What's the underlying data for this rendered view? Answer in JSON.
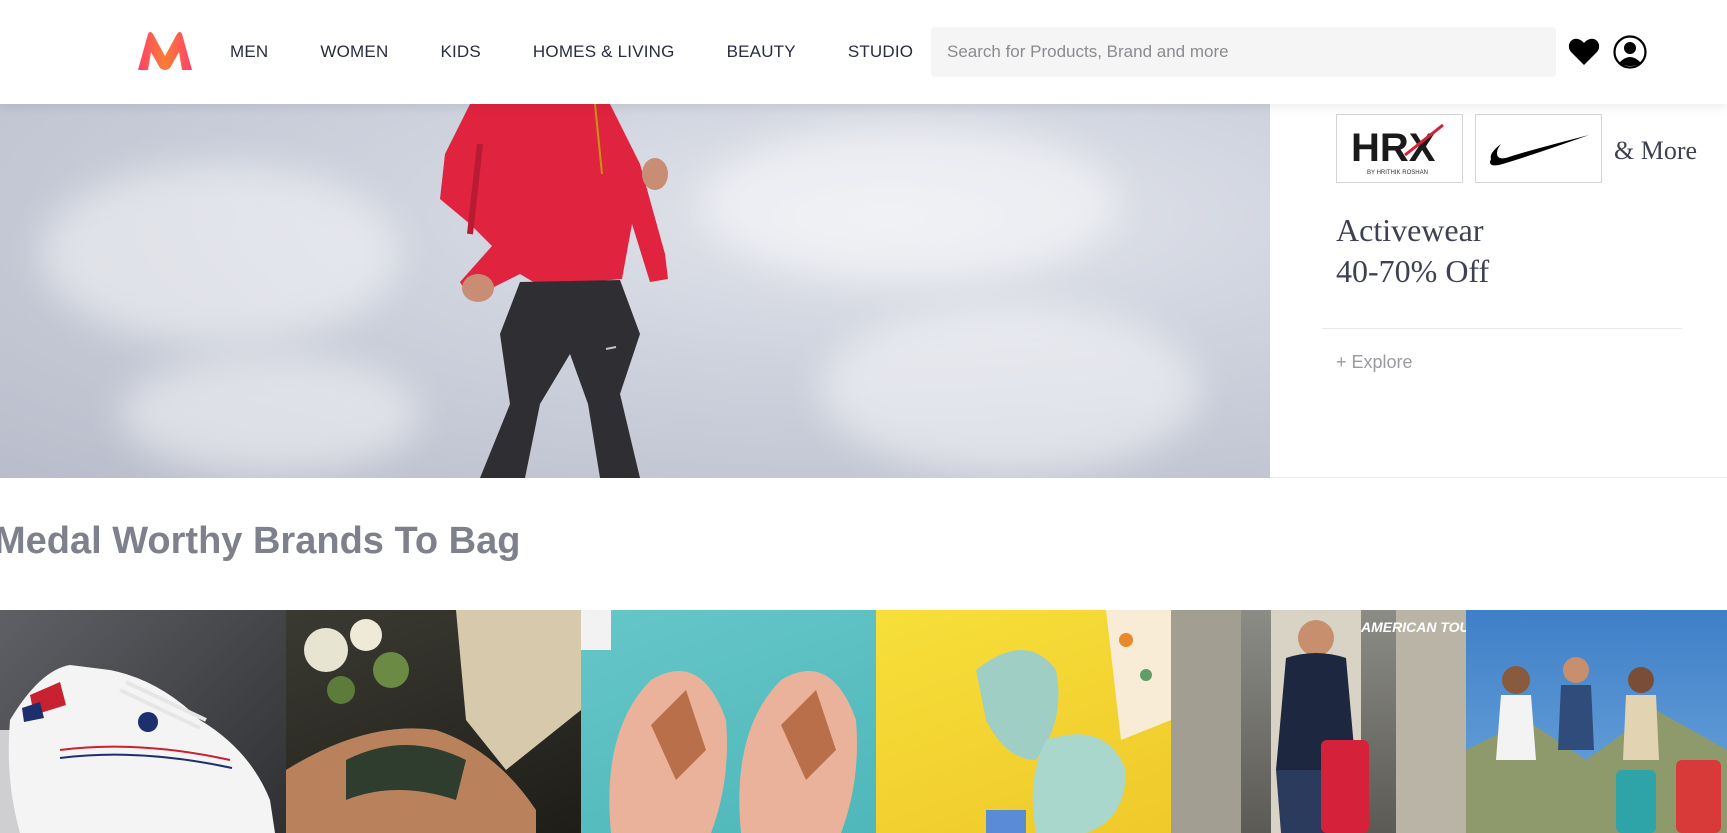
{
  "header": {
    "nav": [
      "MEN",
      "WOMEN",
      "KIDS",
      "HOMES & LIVING",
      "BEAUTY",
      "STUDIO"
    ],
    "search": {
      "placeholder": "Search for Products, Brand and more",
      "value": ""
    },
    "icons": {
      "logo": "myntra-logo",
      "wishlist": "heart-icon",
      "profile": "user-icon"
    }
  },
  "hero": {
    "brands": [
      "HRX",
      "Nike"
    ],
    "hrx_tagline": "BY HRITHIK ROSHAN",
    "and_more": "& More",
    "promo_title": "Activewear",
    "promo_offer": "40-70% Off",
    "explore": "+ Explore"
  },
  "section": {
    "title": "Medal Worthy Brands To Bag",
    "tiles": [
      {
        "name": "U.S. Polo Assn. sneaker",
        "colors": [
          "#5f6065",
          "#2f3033"
        ]
      },
      {
        "name": "Casual shoes",
        "colors": [
          "#3b3a32",
          "#1e1d18"
        ]
      },
      {
        "name": "Flat sandals",
        "colors": [
          "#66c6c8",
          "#4fb7ba"
        ]
      },
      {
        "name": "Embellished mules",
        "colors": [
          "#f7df3a",
          "#efc92a"
        ]
      },
      {
        "name": "American Tourister luggage",
        "colors": [
          "#8c8c86",
          "#5b5a55"
        ],
        "label": "AMERICAN TOURISTER"
      },
      {
        "name": "Travel bags",
        "colors": [
          "#3f7fc7",
          "#6fa8de"
        ]
      }
    ]
  },
  "colors": {
    "brand_pink": "#ff3f6c",
    "brand_orange": "#f97e34",
    "text_dark": "#282c3f",
    "muted": "#7e818c"
  }
}
